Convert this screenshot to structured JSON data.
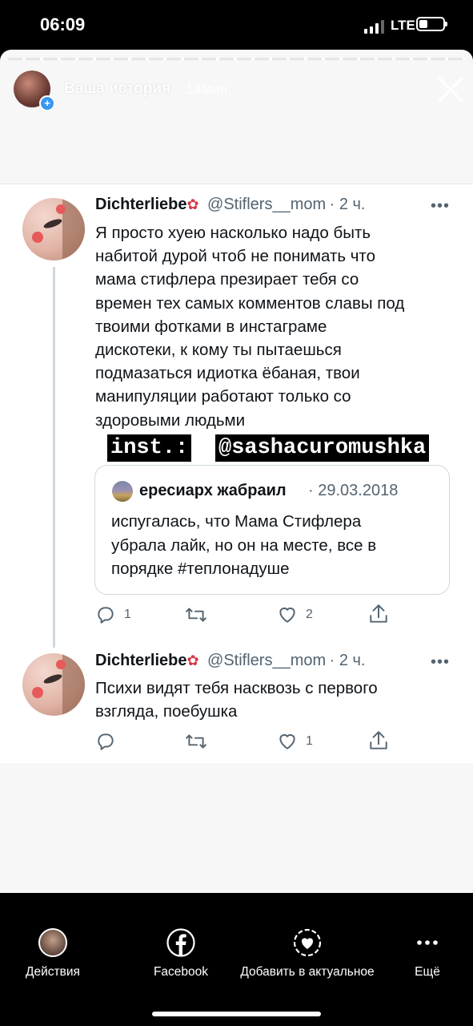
{
  "status_bar": {
    "time": "06:09",
    "network": "LTE"
  },
  "story_header": {
    "user": "Ваша история",
    "time": "14мин."
  },
  "tweet1": {
    "name": "Dichterliebe",
    "handle": "@Stiflers__mom",
    "time": "· 2 ч.",
    "more": "•••",
    "lines": [
      "Я просто хуею насколько надо быть",
      "набитой дурой чтоб не понимать что",
      "мама стифлера презирает тебя со",
      "времен тех самых комментов славы под",
      "твоими фотками в инстаграме",
      "дискотеки, к кому ты пытаешься",
      "подмазаться идиотка ёбаная, твои",
      "манипуляции работают только со",
      "здоровыми людьми"
    ],
    "reply_count": "1",
    "retweet_count": "",
    "like_count": "2"
  },
  "insta_stickers": {
    "label": "inst.:",
    "username": "@sashacuromushka"
  },
  "quoted_tweet": {
    "name": "ересиарх жабраил",
    "date": "· 29.03.2018",
    "lines": [
      "испугалась, что Мама Стифлера",
      "убрала лайк, но он на месте, все в",
      "порядке #теплонадуше"
    ]
  },
  "tweet2": {
    "name": "Dichterliebe",
    "handle": "@Stiflers__mom",
    "time": "· 2 ч.",
    "more": "•••",
    "lines": [
      "Психи видят тебя насквозь с первого",
      "взгляда, поебушка"
    ],
    "reply_count": "",
    "retweet_count": "",
    "like_count": "1"
  },
  "bottom_bar": {
    "actions": "Действия",
    "facebook": "Facebook",
    "highlight": "Добавить в актуальное",
    "more": "Ещё"
  },
  "colors": {
    "name_text": "#0f1419",
    "secondary_text": "#536471",
    "thread_line": "#cfd9de",
    "badge_blue": "#3897f0"
  }
}
